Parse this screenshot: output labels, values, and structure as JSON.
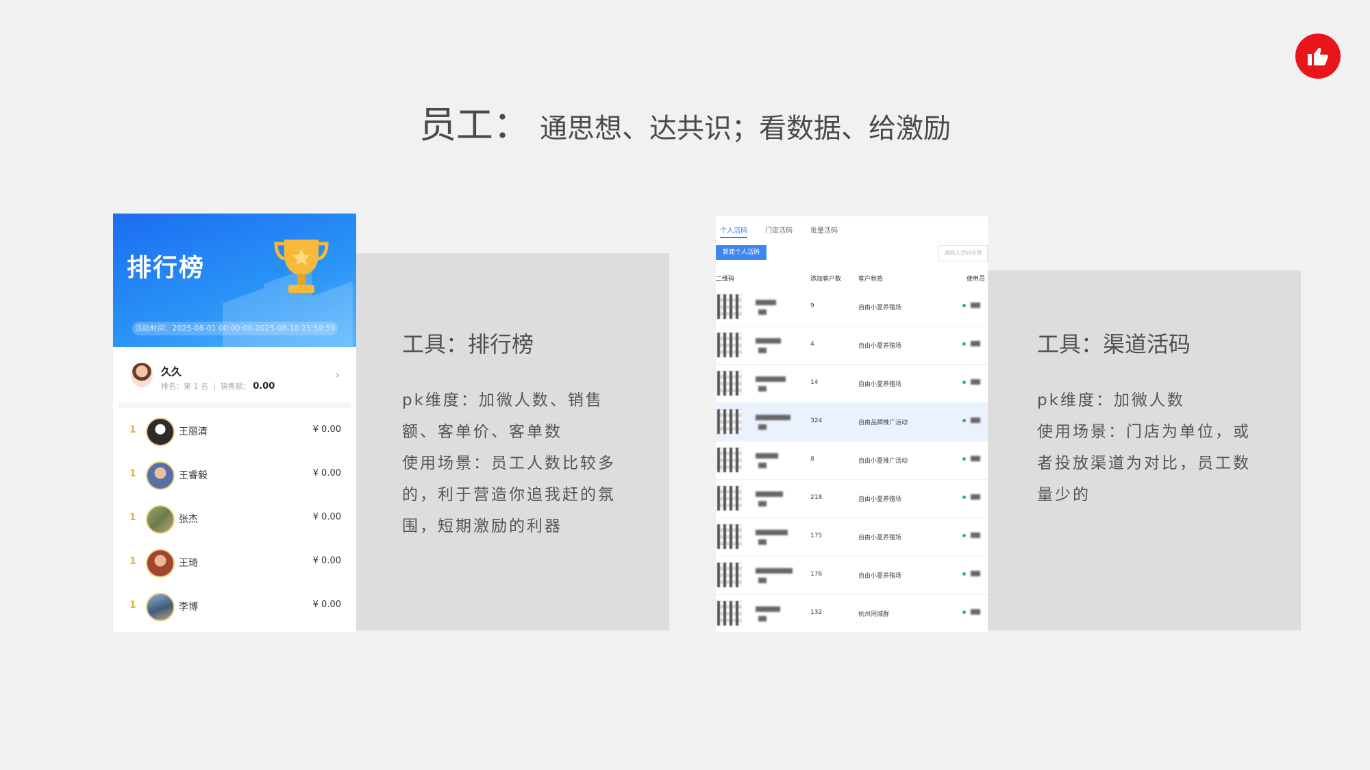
{
  "title": {
    "main": "员工：",
    "sub": "通思想、达共识；看数据、给激励"
  },
  "badge": {
    "icon": "thumbs-up-icon",
    "color": "#e8151b"
  },
  "left_panel": {
    "tool_label": "工具：排行榜",
    "description": [
      "pk维度：加微人数、销售",
      "额、客单价、客单数",
      "使用场景：员工人数比较多",
      "的，利于营造你追我赶的氛",
      "围，短期激励的利器"
    ],
    "screenshot": {
      "header_title": "排行榜",
      "period": "活动时间：2025-08-01 00:00:00-2025-08-10 23:59:59",
      "me": {
        "name": "久久",
        "rank_label": "排名：第 1 名",
        "sales_label": "销售额：",
        "sales_value": "0.00"
      },
      "rows": [
        {
          "rank": "1",
          "name": "王丽清",
          "amount": "¥ 0.00"
        },
        {
          "rank": "1",
          "name": "王睿毅",
          "amount": "¥ 0.00"
        },
        {
          "rank": "1",
          "name": "张杰",
          "amount": "¥ 0.00"
        },
        {
          "rank": "1",
          "name": "王琦",
          "amount": "¥ 0.00"
        },
        {
          "rank": "1",
          "name": "李博",
          "amount": "¥ 0.00"
        }
      ]
    }
  },
  "right_panel": {
    "tool_label": "工具：渠道活码",
    "description": [
      "pk维度：加微人数",
      "使用场景：门店为单位，或",
      "者投放渠道为对比，员工数",
      "量少的"
    ],
    "screenshot": {
      "tabs": [
        "个人活码",
        "门店活码",
        "批量活码"
      ],
      "add_button": "新建个人活码",
      "search_placeholder": "请输入活码名称",
      "columns": [
        "二维码",
        "添加客户数",
        "客户标签",
        "使用员"
      ],
      "rows": [
        {
          "count": "9",
          "tag": "自由小夏养殖场",
          "highlight": false
        },
        {
          "count": "4",
          "tag": "自由小夏养殖场",
          "highlight": false
        },
        {
          "count": "14",
          "tag": "自由小夏养殖场",
          "highlight": false
        },
        {
          "count": "324",
          "tag": "自由品牌推广活动",
          "highlight": true
        },
        {
          "count": "8",
          "tag": "自由小夏推广活动",
          "highlight": false
        },
        {
          "count": "218",
          "tag": "自由小夏养殖场",
          "highlight": false
        },
        {
          "count": "175",
          "tag": "自由小夏养殖场",
          "highlight": false
        },
        {
          "count": "176",
          "tag": "自由小夏养殖场",
          "highlight": false
        },
        {
          "count": "132",
          "tag": "杭州同城群",
          "highlight": false
        }
      ]
    }
  }
}
